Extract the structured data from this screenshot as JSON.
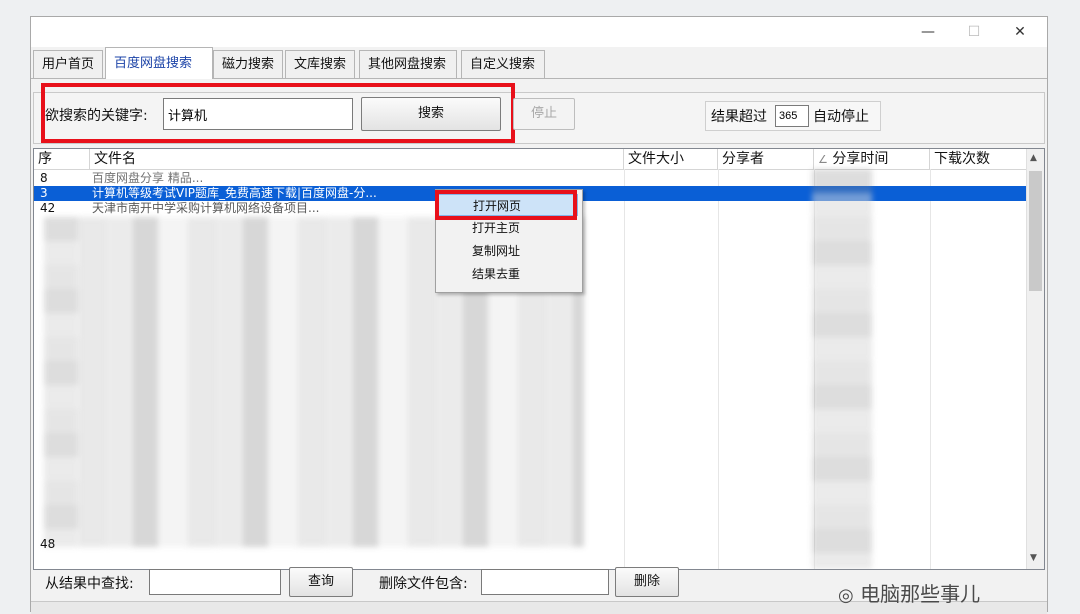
{
  "window": {
    "controls": {
      "minimize": "—",
      "maximize": "☐",
      "close": "✕"
    }
  },
  "tabs": [
    {
      "label": "用户首页"
    },
    {
      "label": "百度网盘搜索"
    },
    {
      "label": "磁力搜索"
    },
    {
      "label": "文库搜索"
    },
    {
      "label": "其他网盘搜索"
    },
    {
      "label": "自定义搜索"
    }
  ],
  "search": {
    "keyword_label": "欲搜索的关键字:",
    "keyword_value": "计算机",
    "search_button": "搜索",
    "stop_button": "停止",
    "limit_prefix": "结果超过",
    "limit_value": "365",
    "limit_suffix": "自动停止"
  },
  "list": {
    "columns": [
      "序",
      "文件名",
      "文件大小",
      "分享者",
      "分享时间",
      "下载次数"
    ],
    "sort_indicator": "∠",
    "rows": [
      {
        "index": "8",
        "name": "百度网盘分享 精品..."
      },
      {
        "index": "3",
        "name": "计算机等级考试VIP题库_免费高速下载|百度网盘-分...",
        "selected": true
      },
      {
        "index": "42",
        "name": "天津市南开中学采购计算机网络设备项目..."
      },
      {
        "index": "48",
        "name": ""
      }
    ]
  },
  "context_menu": {
    "items": [
      "打开网页",
      "打开主页",
      "复制网址",
      "结果去重"
    ]
  },
  "filter": {
    "find_label": "从结果中查找:",
    "find_value": "",
    "query_button": "查询",
    "delete_label": "删除文件包含:",
    "delete_value": "",
    "delete_button": "删除"
  },
  "watermark": {
    "text": "电脑那些事儿"
  },
  "colors": {
    "highlight_red": "#e8101a",
    "selection_blue": "#0a5fd6",
    "active_tab_text": "#1d44a8"
  }
}
